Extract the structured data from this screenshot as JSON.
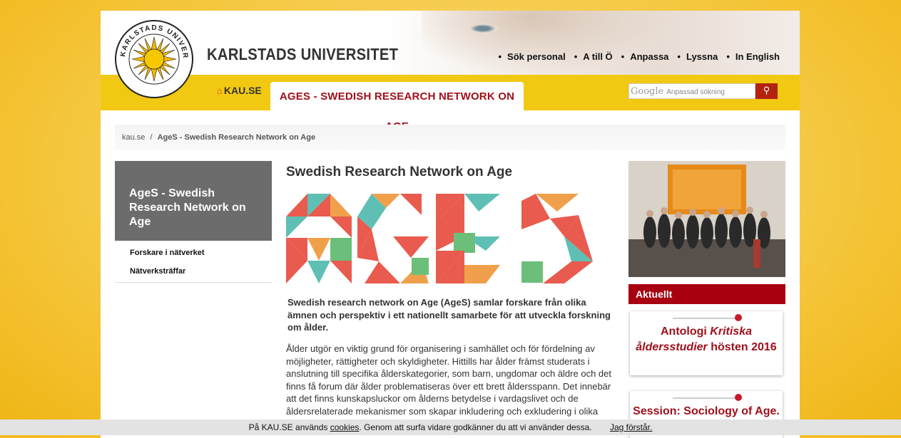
{
  "header": {
    "university_name": "KARLSTADS UNIVERSITET",
    "logo_text": "KARLSTADS UNIVERSITET",
    "top_links": [
      "Sök personal",
      "A till Ö",
      "Anpassa",
      "Lyssna",
      "In English"
    ]
  },
  "nav": {
    "home_label": "KAU.SE",
    "active_tab": "AGES - SWEDISH RESEARCH NETWORK ON AGE",
    "search_placeholder": "Anpassad sökning",
    "search_brand": "Google"
  },
  "breadcrumb": {
    "home": "kau.se",
    "separator": "/",
    "current": "AgeS - Swedish Research Network on Age"
  },
  "sidebar": {
    "title": "AgeS - Swedish Research Network on Age",
    "items": [
      "Forskare i nätverket",
      "Nätverksträffar"
    ]
  },
  "main": {
    "title": "Swedish Research Network on Age",
    "lead": "Swedish research network on Age (AgeS) samlar forskare från olika ämnen och perspektiv i ett nationellt samarbete för att utveckla forskning om ålder.",
    "body": "Ålder utgör en viktig grund för organisering i samhället och för fördelning av möjligheter, rättigheter och skyldigheter. Hittills har ålder främst studerats i anslutning till specifika ålderskategorier, som barn, ungdomar och äldre och det finns få forum där ålder problematiseras över ett brett åldersspann. Det innebär att det finns kunskapsluckor om ålderns betydelse i vardagslivet och de åldersrelaterade mekanismer som skapar inkludering och exkludering i olika sammanhang i samhället, till exempel i arbetsliv, utbildning, vård och"
  },
  "right": {
    "aktuellt_label": "Aktuellt",
    "card1": {
      "prefix": "Antologi ",
      "italic": "Kritiska åldersstudier",
      "suffix": " hösten 2016"
    },
    "card2": {
      "text": "Session: Sociology of Age."
    }
  },
  "cookie": {
    "prefix": "På KAU.SE används ",
    "link": "cookies",
    "suffix": ". Genom att surfa vidare godkänner du att vi använder dessa.",
    "accept": "Jag förstår."
  },
  "colors": {
    "brand_yellow": "#f2c912",
    "brand_red": "#a0101b",
    "sidebar_gray": "#6c6c6c"
  }
}
